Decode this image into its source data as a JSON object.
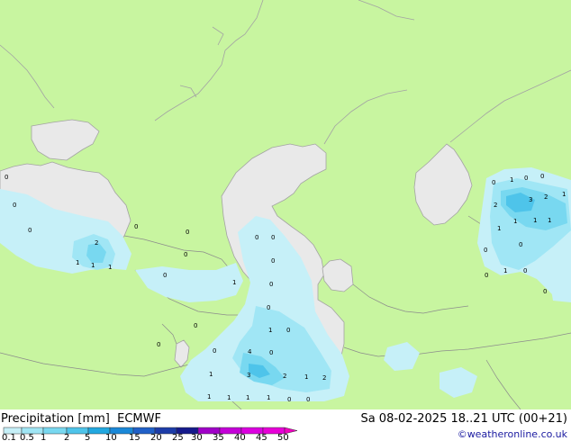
{
  "title": {
    "variable": "Precipitation [mm]",
    "model": "ECMWF",
    "valid_time": "Sa 08-02-2025 18..21 UTC (00+21)"
  },
  "credit": "©weatheronline.co.uk",
  "colors": {
    "land": "#c8f5a0",
    "sea": "#e9e9e9",
    "coast": "#a3a3a3",
    "border": "#8c8c8c"
  },
  "legend": {
    "ticks": [
      "0.1",
      "0.5",
      "1",
      "2",
      "5",
      "10",
      "15",
      "20",
      "25",
      "30",
      "35",
      "40",
      "45",
      "50"
    ],
    "colors": [
      "#c6f0f8",
      "#a0e6f5",
      "#78d8f0",
      "#4ec4ea",
      "#22a8e0",
      "#1a88d8",
      "#2060c8",
      "#1c3ca8",
      "#151a8c",
      "#a000c8",
      "#c400d8",
      "#dc00e0",
      "#e800d8",
      "#f000c0"
    ]
  },
  "precip_labels": [
    {
      "v": "0",
      "loc": "Black Sea W"
    },
    {
      "v": "0",
      "loc": "Black Sea"
    },
    {
      "v": "0",
      "loc": "Black Sea"
    },
    {
      "v": "2",
      "loc": "Black Sea E"
    },
    {
      "v": "1",
      "loc": "Black Sea SE"
    },
    {
      "v": "1",
      "loc": "Black Sea SE"
    },
    {
      "v": "1",
      "loc": "Black Sea SE"
    },
    {
      "v": "0",
      "loc": "Caucasus"
    },
    {
      "v": "0",
      "loc": "Caucasus"
    },
    {
      "v": "0",
      "loc": "Caucasus"
    },
    {
      "v": "0",
      "loc": "Georgia"
    },
    {
      "v": "1",
      "loc": "Azerbaijan"
    },
    {
      "v": "0",
      "loc": "Armenia"
    },
    {
      "v": "0",
      "loc": "Caspian"
    },
    {
      "v": "0",
      "loc": "Caspian"
    },
    {
      "v": "0",
      "loc": "Caspian"
    },
    {
      "v": "0",
      "loc": "Caspian S"
    },
    {
      "v": "0",
      "loc": "Caspian S"
    },
    {
      "v": "1",
      "loc": "Caspian S"
    },
    {
      "v": "0",
      "loc": "Caspian S"
    },
    {
      "v": "0",
      "loc": "Iran NW"
    },
    {
      "v": "0",
      "loc": "Iran NW"
    },
    {
      "v": "4",
      "loc": "Iran N"
    },
    {
      "v": "0",
      "loc": "Iran N"
    },
    {
      "v": "1",
      "loc": "Iran"
    },
    {
      "v": "3",
      "loc": "Iran"
    },
    {
      "v": "2",
      "loc": "Iran"
    },
    {
      "v": "1",
      "loc": "Iran"
    },
    {
      "v": "2",
      "loc": "Iran"
    },
    {
      "v": "1",
      "loc": "Iran S"
    },
    {
      "v": "1",
      "loc": "Iran S"
    },
    {
      "v": "1",
      "loc": "Iran S"
    },
    {
      "v": "1",
      "loc": "Iran S"
    },
    {
      "v": "0",
      "loc": "Iran S"
    },
    {
      "v": "0",
      "loc": "Iran S"
    },
    {
      "v": "1",
      "loc": "Kazakhstan E"
    },
    {
      "v": "0",
      "loc": "Kazakhstan E"
    },
    {
      "v": "0",
      "loc": "Kazakhstan E"
    },
    {
      "v": "0",
      "loc": "Kazakhstan E"
    },
    {
      "v": "3",
      "loc": "Kazakhstan E"
    },
    {
      "v": "2",
      "loc": "Kazakhstan E"
    },
    {
      "v": "1",
      "loc": "Kazakhstan E"
    },
    {
      "v": "2",
      "loc": "Kazakhstan E"
    },
    {
      "v": "1",
      "loc": "Kazakhstan E"
    },
    {
      "v": "1",
      "loc": "Kazakhstan E"
    },
    {
      "v": "1",
      "loc": "Kazakhstan E"
    },
    {
      "v": "1",
      "loc": "Kazakhstan E"
    },
    {
      "v": "0",
      "loc": "Kazakhstan E"
    },
    {
      "v": "0",
      "loc": "Kazakhstan E"
    },
    {
      "v": "1",
      "loc": "Kazakhstan E"
    },
    {
      "v": "0",
      "loc": "Kazakhstan E"
    },
    {
      "v": "0",
      "loc": "Kazakhstan E"
    },
    {
      "v": "0",
      "loc": "Kazakhstan E"
    }
  ]
}
